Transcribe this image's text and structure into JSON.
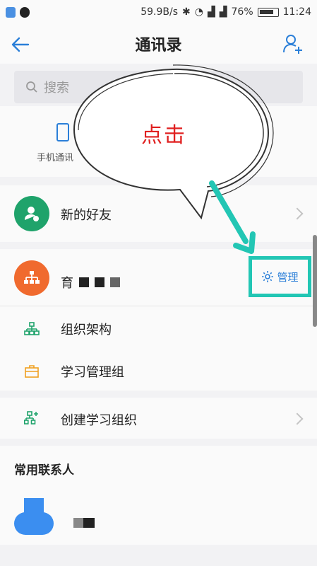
{
  "status_bar": {
    "speed": "59.9B/s",
    "battery": "76%",
    "time": "11:24"
  },
  "header": {
    "title": "通讯录",
    "back_icon": "arrow-left-icon",
    "add_icon": "add-user-icon"
  },
  "search": {
    "placeholder": "搜索"
  },
  "quick_items": [
    {
      "label": "手机通讯",
      "icon": "phone-icon"
    }
  ],
  "new_friends": {
    "label": "新的好友",
    "icon_color": "#1fa36b"
  },
  "organization": {
    "name_visible": "育",
    "manage_label": "管理",
    "icon_color": "#f06a2e",
    "items": [
      {
        "label": "组织架构",
        "icon": "org-chart-icon",
        "color": "#1fa36b"
      },
      {
        "label": "学习管理组",
        "icon": "briefcase-icon",
        "color": "#f0a020"
      }
    ]
  },
  "create_group": {
    "label": "创建学习组织",
    "icon": "add-org-icon",
    "color": "#1fa36b"
  },
  "frequent_contacts": {
    "section_title": "常用联系人"
  },
  "annotation": {
    "text": "点击",
    "accent": "#22c6b4"
  }
}
